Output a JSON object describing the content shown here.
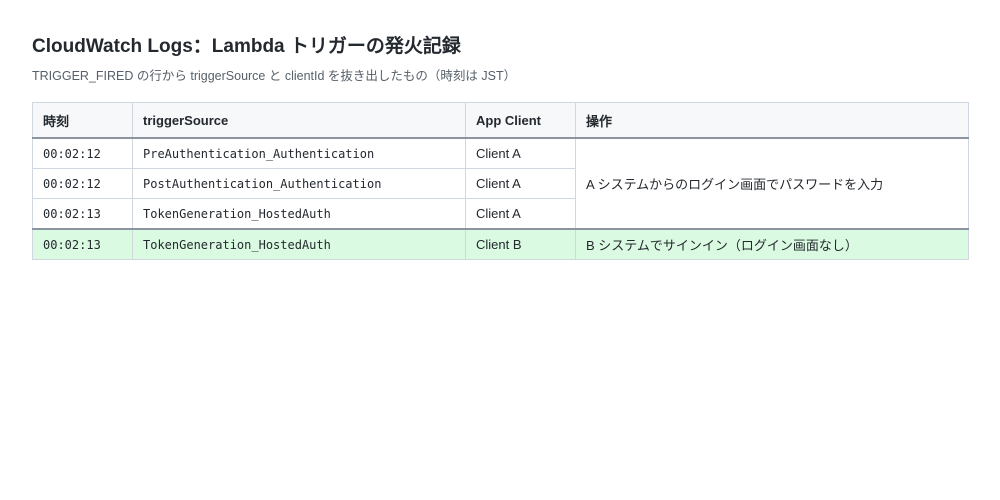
{
  "header": {
    "title": "CloudWatch Logs：Lambda トリガーの発火記録",
    "subtitle": "TRIGGER_FIRED の行から triggerSource と clientId を抜き出したもの（時刻は JST）"
  },
  "table": {
    "columns": [
      "時刻",
      "triggerSource",
      "App Client",
      "操作"
    ],
    "rows": [
      {
        "time": "00:02:12",
        "trigger_source": "PreAuthentication_Authentication",
        "app_client": "Client A"
      },
      {
        "time": "00:02:12",
        "trigger_source": "PostAuthentication_Authentication",
        "app_client": "Client A"
      },
      {
        "time": "00:02:13",
        "trigger_source": "TokenGeneration_HostedAuth",
        "app_client": "Client A"
      },
      {
        "time": "00:02:13",
        "trigger_source": "TokenGeneration_HostedAuth",
        "app_client": "Client B"
      }
    ],
    "operations": [
      "A システムからのログイン画面でパスワードを入力",
      "B システムでサインイン（ログイン画面なし）"
    ]
  },
  "colors": {
    "highlight_row": "#dafbe1",
    "header_bg": "#f6f8fa",
    "border": "#d0d7de"
  }
}
